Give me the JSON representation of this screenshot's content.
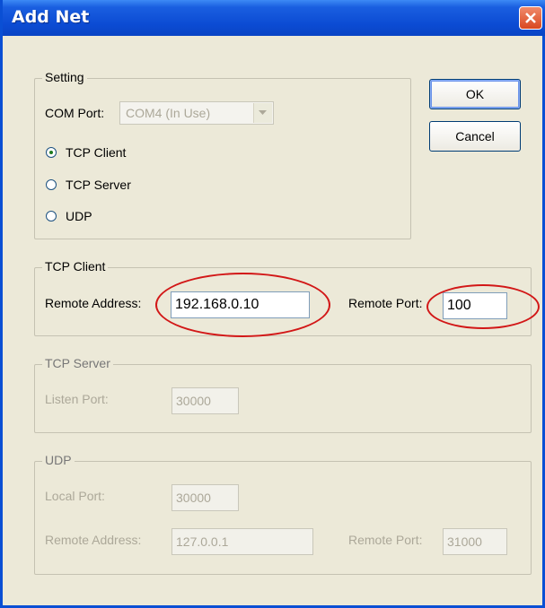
{
  "window": {
    "title": "Add Net"
  },
  "buttons": {
    "ok": "OK",
    "cancel": "Cancel"
  },
  "setting": {
    "legend": "Setting",
    "com_port_label": "COM Port:",
    "com_port_value": "COM4 (In Use)",
    "modes": [
      {
        "label": "TCP Client",
        "checked": true
      },
      {
        "label": "TCP Server",
        "checked": false
      },
      {
        "label": "UDP",
        "checked": false
      }
    ]
  },
  "tcp_client": {
    "legend": "TCP Client",
    "remote_address_label": "Remote Address:",
    "remote_address_value": "192.168.0.10",
    "remote_port_label": "Remote Port:",
    "remote_port_value": "100"
  },
  "tcp_server": {
    "legend": "TCP Server",
    "listen_port_label": "Listen Port:",
    "listen_port_value": "30000"
  },
  "udp": {
    "legend": "UDP",
    "local_port_label": "Local Port:",
    "local_port_value": "30000",
    "remote_address_label": "Remote Address:",
    "remote_address_value": "127.0.0.1",
    "remote_port_label": "Remote Port:",
    "remote_port_value": "31000"
  },
  "colors": {
    "title_bar": "#0a4fd4",
    "annotation": "#d21717",
    "close_button": "#d9481f"
  }
}
